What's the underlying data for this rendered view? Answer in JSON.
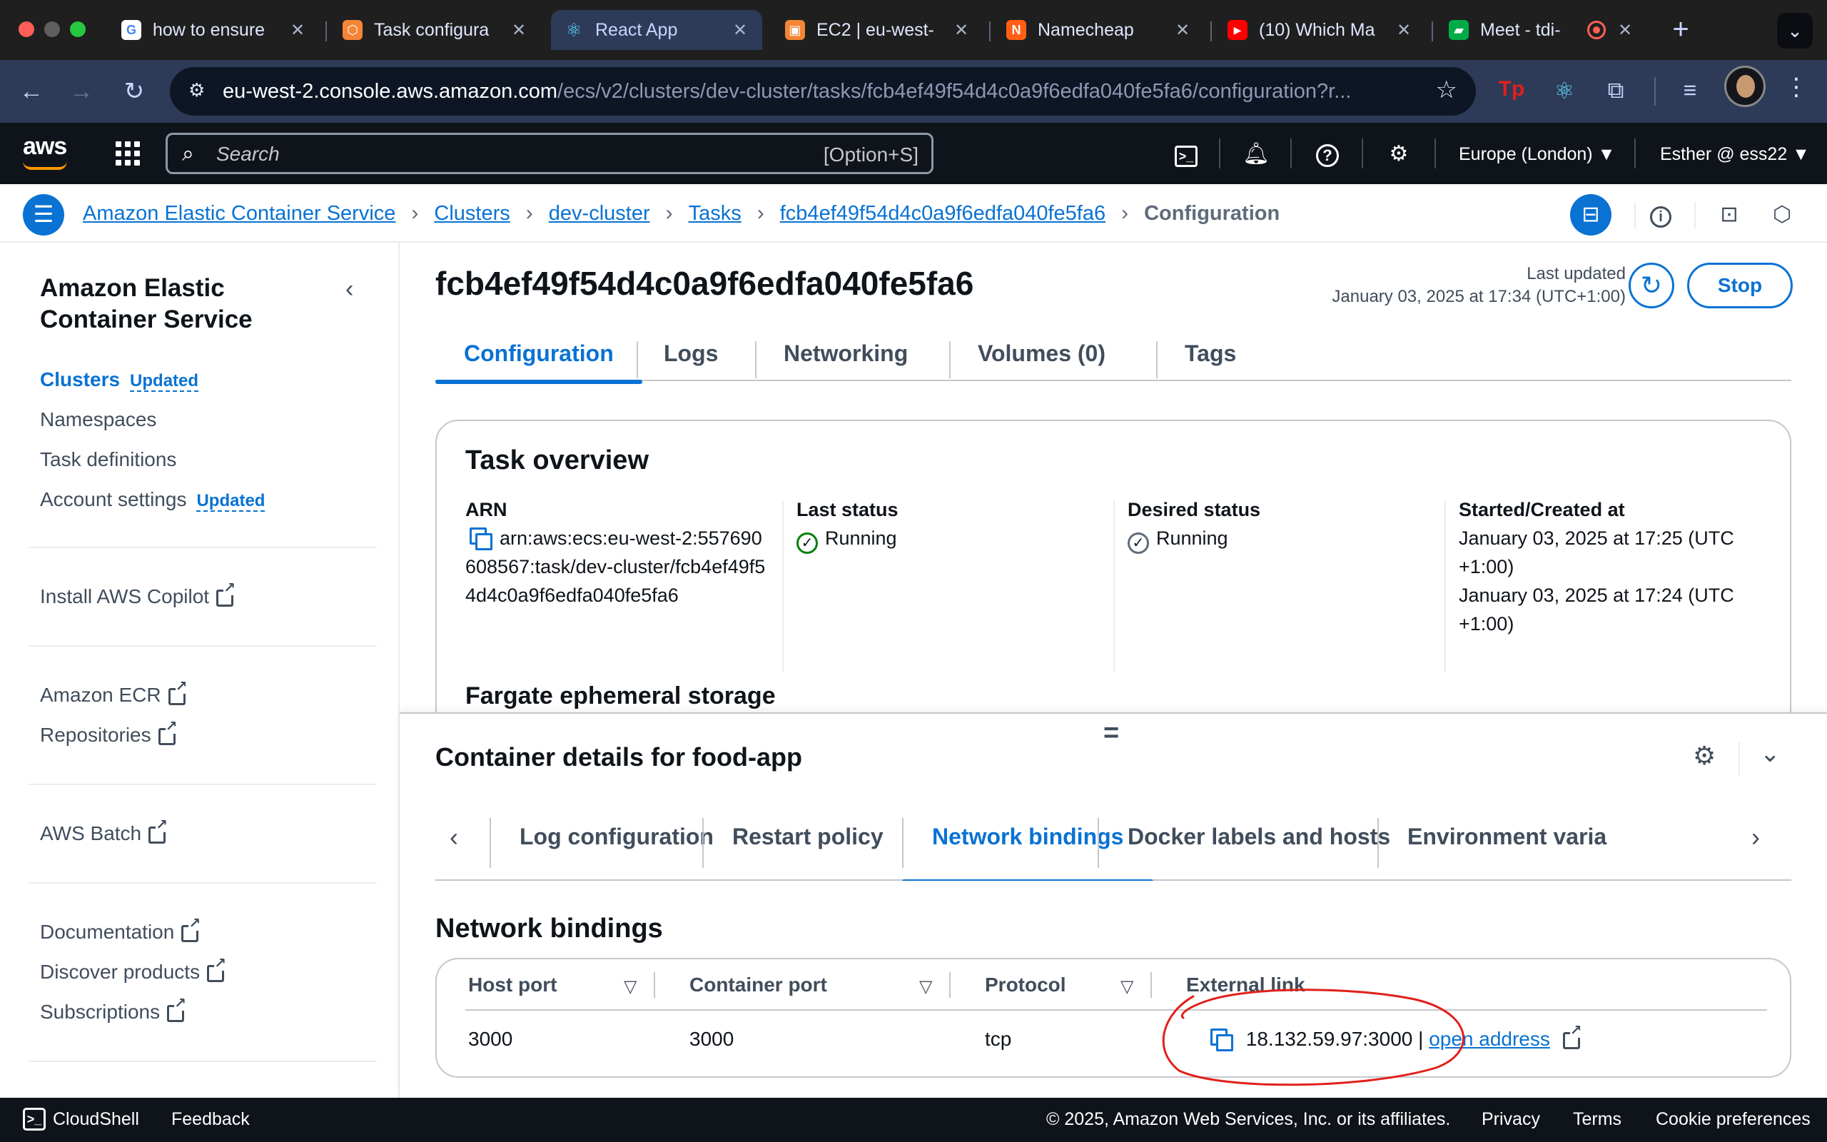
{
  "browser": {
    "tabs": [
      {
        "title": "how to ensure",
        "favicon": "google-icon",
        "color": "#ffffff"
      },
      {
        "title": "Task configura",
        "favicon": "aws-ecs-icon",
        "color": "#f58536"
      },
      {
        "title": "React App",
        "favicon": "react-icon",
        "color": "#61dafb"
      },
      {
        "title": "EC2 | eu-west-",
        "favicon": "aws-ec2-icon",
        "color": "#f58536"
      },
      {
        "title": "Namecheap",
        "favicon": "namecheap-icon",
        "color": "#ff5f15"
      },
      {
        "title": "(10) Which Ma",
        "favicon": "youtube-icon",
        "color": "#ff0000"
      },
      {
        "title": "Meet - tdi-",
        "favicon": "meet-icon",
        "color": "#00ac47"
      }
    ],
    "url_host": "eu-west-2.console.aws.amazon.com",
    "url_path": "/ecs/v2/clusters/dev-cluster/tasks/fcb4ef49f54d4c0a9f6edfa040fe5fa6/configuration?r..."
  },
  "aws_nav": {
    "logo": "aws",
    "search_placeholder": "Search",
    "search_shortcut": "[Option+S]",
    "region": "Europe (London) ▼",
    "account": "Esther @ ess22 ▼"
  },
  "breadcrumbs": {
    "items": [
      "Amazon Elastic Container Service",
      "Clusters",
      "dev-cluster",
      "Tasks",
      "fcb4ef49f54d4c0a9f6edfa040fe5fa6"
    ],
    "current": "Configuration"
  },
  "sidenav": {
    "title": "Amazon Elastic Container Service",
    "clusters": "Clusters",
    "clusters_badge": "Updated",
    "namespaces": "Namespaces",
    "task_definitions": "Task definitions",
    "account_settings": "Account settings",
    "account_badge": "Updated",
    "install_copilot": "Install AWS Copilot",
    "amazon_ecr": "Amazon ECR",
    "repositories": "Repositories",
    "aws_batch": "AWS Batch",
    "documentation": "Documentation",
    "discover_products": "Discover products",
    "subscriptions": "Subscriptions"
  },
  "page": {
    "title": "fcb4ef49f54d4c0a9f6edfa040fe5fa6",
    "last_updated_label": "Last updated",
    "last_updated_value": "January 03, 2025 at 17:34 (UTC+1:00)",
    "stop_label": "Stop",
    "tabs": [
      "Configuration",
      "Logs",
      "Networking",
      "Volumes (0)",
      "Tags"
    ]
  },
  "overview": {
    "heading": "Task overview",
    "arn_label": "ARN",
    "arn_value": "arn:aws:ecs:eu-west-2:557690608567:task/dev-cluster/fcb4ef49f54d4c0a9f6edfa040fe5fa6",
    "last_status_label": "Last status",
    "last_status_value": "Running",
    "desired_status_label": "Desired status",
    "desired_status_value": "Running",
    "started_label": "Started/Created at",
    "started_value": "January 03, 2025 at 17:25 (UTC+1:00)",
    "created_value": "January 03, 2025 at 17:24 (UTC+1:00)",
    "fargate_heading": "Fargate ephemeral storage"
  },
  "container": {
    "title": "Container details for food-app",
    "tabs": [
      "Log configuration",
      "Restart policy",
      "Network bindings",
      "Docker labels and hosts",
      "Environment varia"
    ],
    "active_tab": "Network bindings",
    "section_heading": "Network bindings",
    "columns": [
      "Host port",
      "Container port",
      "Protocol",
      "External link"
    ],
    "row": {
      "host_port": "3000",
      "container_port": "3000",
      "protocol": "tcp",
      "external_address": "18.132.59.97:3000",
      "separator": "|",
      "link_label": "open address"
    }
  },
  "footer": {
    "cloudshell": "CloudShell",
    "feedback": "Feedback",
    "copyright": "© 2025, Amazon Web Services, Inc. or its affiliates.",
    "privacy": "Privacy",
    "terms": "Terms",
    "cookies": "Cookie preferences"
  },
  "colors": {
    "accent": "#0972d3",
    "running": "#037f0c",
    "annotation": "#e0201b",
    "aws_orange": "#ff9900"
  }
}
